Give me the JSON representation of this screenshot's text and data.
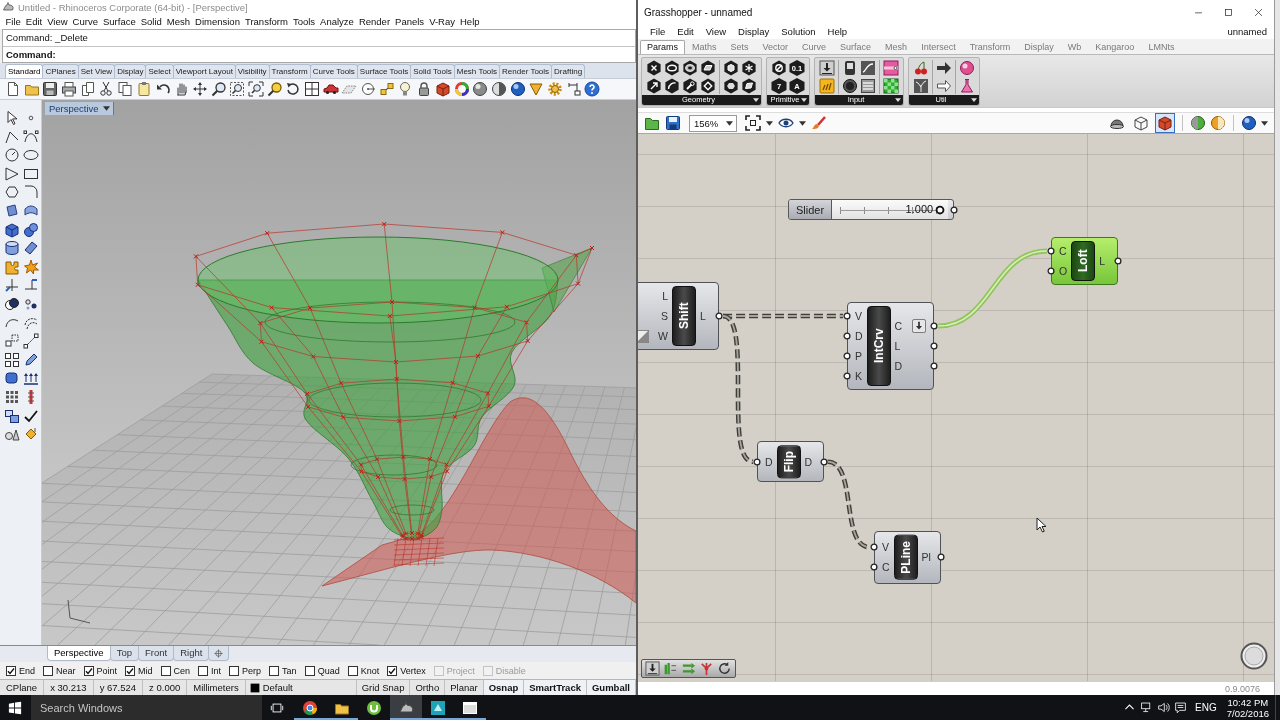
{
  "rhino": {
    "title": "Untitled - Rhinoceros Corporate (64-bit) - [Perspective]",
    "menu": [
      "File",
      "Edit",
      "View",
      "Curve",
      "Surface",
      "Solid",
      "Mesh",
      "Dimension",
      "Transform",
      "Tools",
      "Analyze",
      "Render",
      "Panels",
      "V-Ray",
      "Help"
    ],
    "command_history": "Command: _Delete",
    "command_prompt": "Command:",
    "toolbar_tabs": [
      {
        "label": "Standard",
        "selected": true
      },
      {
        "label": "CPlanes",
        "selected": false
      },
      {
        "label": "Set View",
        "selected": false
      },
      {
        "label": "Display",
        "selected": false
      },
      {
        "label": "Select",
        "selected": false
      },
      {
        "label": "Viewport Layout",
        "selected": false
      },
      {
        "label": "Visibility",
        "selected": false
      },
      {
        "label": "Transform",
        "selected": false
      },
      {
        "label": "Curve Tools",
        "selected": false
      },
      {
        "label": "Surface Tools",
        "selected": false
      },
      {
        "label": "Solid Tools",
        "selected": false
      },
      {
        "label": "Mesh Tools",
        "selected": false
      },
      {
        "label": "Render Tools",
        "selected": false
      },
      {
        "label": "Drafting",
        "selected": false
      }
    ],
    "viewport": {
      "label": "Perspective"
    },
    "viewport_tabs": [
      {
        "label": "Perspective",
        "selected": true
      },
      {
        "label": "Top",
        "selected": false
      },
      {
        "label": "Front",
        "selected": false
      },
      {
        "label": "Right",
        "selected": false
      }
    ],
    "osnaps": [
      {
        "label": "End",
        "checked": true,
        "disabled": false
      },
      {
        "label": "Near",
        "checked": false,
        "disabled": false
      },
      {
        "label": "Point",
        "checked": true,
        "disabled": false
      },
      {
        "label": "Mid",
        "checked": true,
        "disabled": false
      },
      {
        "label": "Cen",
        "checked": false,
        "disabled": false
      },
      {
        "label": "Int",
        "checked": false,
        "disabled": false
      },
      {
        "label": "Perp",
        "checked": false,
        "disabled": false
      },
      {
        "label": "Tan",
        "checked": false,
        "disabled": false
      },
      {
        "label": "Quad",
        "checked": false,
        "disabled": false
      },
      {
        "label": "Knot",
        "checked": false,
        "disabled": false
      },
      {
        "label": "Vertex",
        "checked": true,
        "disabled": false
      },
      {
        "label": "Project",
        "checked": false,
        "disabled": true
      },
      {
        "label": "Disable",
        "checked": false,
        "disabled": true
      }
    ],
    "status_bar": [
      {
        "kind": "field",
        "text": "CPlane"
      },
      {
        "kind": "field",
        "text": "x 30.213"
      },
      {
        "kind": "field",
        "text": "y 67.524"
      },
      {
        "kind": "field",
        "text": "z 0.000"
      },
      {
        "kind": "field",
        "text": "Millimeters"
      },
      {
        "kind": "layer",
        "text": "Default"
      },
      {
        "kind": "toggle",
        "text": "Grid Snap",
        "on": false
      },
      {
        "kind": "toggle",
        "text": "Ortho",
        "on": false
      },
      {
        "kind": "toggle",
        "text": "Planar",
        "on": false
      },
      {
        "kind": "toggle",
        "text": "Osnap",
        "on": true
      },
      {
        "kind": "toggle",
        "text": "SmartTrack",
        "on": true
      },
      {
        "kind": "toggle",
        "text": "Gumball",
        "on": true
      }
    ]
  },
  "grasshopper": {
    "title": "Grasshopper - unnamed",
    "menu": [
      "File",
      "Edit",
      "View",
      "Display",
      "Solution",
      "Help"
    ],
    "document": "unnamed",
    "tabs": [
      {
        "label": "Params",
        "selected": true
      },
      {
        "label": "Maths",
        "selected": false
      },
      {
        "label": "Sets",
        "selected": false
      },
      {
        "label": "Vector",
        "selected": false
      },
      {
        "label": "Curve",
        "selected": false
      },
      {
        "label": "Surface",
        "selected": false
      },
      {
        "label": "Mesh",
        "selected": false
      },
      {
        "label": "Intersect",
        "selected": false
      },
      {
        "label": "Transform",
        "selected": false
      },
      {
        "label": "Display",
        "selected": false
      },
      {
        "label": "Wb",
        "selected": false
      },
      {
        "label": "Kangaroo",
        "selected": false
      },
      {
        "label": "LMNts",
        "selected": false
      }
    ],
    "panel_groups": [
      {
        "label": "Geometry"
      },
      {
        "label": "Primitive",
        "glyphs": [
          "0.1",
          "7",
          "A"
        ]
      },
      {
        "label": "Input"
      },
      {
        "label": "Util"
      }
    ],
    "zoom": "156%",
    "preview_modes": [
      {
        "selected": false
      },
      {
        "selected": false
      },
      {
        "selected": true
      }
    ],
    "slider": {
      "label": "Slider",
      "value": "1.000",
      "level": 1
    },
    "components": [
      {
        "name": "Loft",
        "inputs": [
          "C",
          "O"
        ],
        "outputs": [
          {
            "label": "L",
            "grafted": false
          }
        ],
        "selected": true
      },
      {
        "name": "Shift",
        "inputs": [
          "L",
          "S",
          "W"
        ],
        "outputs": [
          {
            "label": "L",
            "grafted": false
          }
        ],
        "selected": false
      },
      {
        "name": "IntCrv",
        "inputs": [
          "V",
          "D",
          "P",
          "K"
        ],
        "outputs": [
          {
            "label": "C",
            "grafted": true
          },
          {
            "label": "L",
            "grafted": false
          },
          {
            "label": "D",
            "grafted": false
          }
        ],
        "selected": false
      },
      {
        "name": "Flip",
        "inputs": [
          "D"
        ],
        "outputs": [
          {
            "label": "D",
            "grafted": false
          }
        ],
        "selected": false
      },
      {
        "name": "PLine",
        "inputs": [
          "V",
          "C"
        ],
        "outputs": [
          {
            "label": "Pl",
            "grafted": false
          }
        ],
        "selected": false
      }
    ],
    "version": "0.9.0076"
  },
  "taskbar": {
    "search_placeholder": "Search Windows",
    "apps": [
      {
        "running": true,
        "selected": false
      },
      {
        "running": true,
        "selected": false
      },
      {
        "running": false,
        "selected": false
      },
      {
        "running": true,
        "selected": true
      },
      {
        "running": true,
        "selected": false
      },
      {
        "running": true,
        "selected": false
      }
    ],
    "language": "ENG",
    "time": "10:42 PM",
    "date": "7/02/2016"
  }
}
